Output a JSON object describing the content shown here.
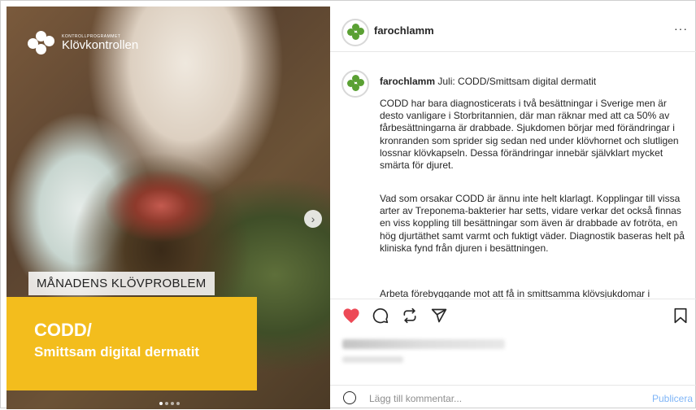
{
  "media": {
    "brand_small": "KONTROLLPROGRAMMET",
    "brand_name": "Klövkontrollen",
    "label": "MÅNADENS KLÖVPROBLEM",
    "title_line1": "CODD/",
    "title_line2": "Smittsam digital dermatit",
    "next_icon": "chevron-right-icon",
    "carousel_pages": 4,
    "carousel_current": 1
  },
  "post": {
    "username": "farochlamm",
    "more_icon": "ellipsis-icon",
    "caption_user": "farochlamm",
    "caption_title": "Juli: CODD/Smittsam digital dermatit",
    "paragraph1": "CODD har bara diagnosticerats i två besättningar i Sverige men är desto vanligare i Storbritannien, där man räknar med att ca 50% av fårbesättningarna är drabbade. Sjukdomen börjar med förändringar i kronranden som sprider sig sedan ned under klövhornet och slutligen lossnar klövkapseln. Dessa förändringar innebär självklart mycket smärta för djuret.",
    "paragraph2": "Vad som orsakar CODD är ännu inte helt klarlagt. Kopplingar till vissa arter av Treponema-bakterier har setts, vidare verkar det också finnas en viss koppling till besättningar som även är drabbade av fotröta, en hög djurtäthet samt varmt och fuktigt väder. Diagnostik baseras helt på kliniska fynd från djuren i besättningen.",
    "paragraph3": "Arbeta förebyggande mot att få in smittsamma klövsjukdomar i"
  },
  "actions": {
    "like_icon": "heart-filled-icon",
    "comment_icon": "comment-icon",
    "share_icon": "repost-icon",
    "send_icon": "send-icon",
    "save_icon": "bookmark-icon",
    "like_color": "#ed4956"
  },
  "comment": {
    "placeholder": "Lägg till kommentar...",
    "post_label": "Publicera",
    "emoji_icon": "emoji-icon"
  }
}
